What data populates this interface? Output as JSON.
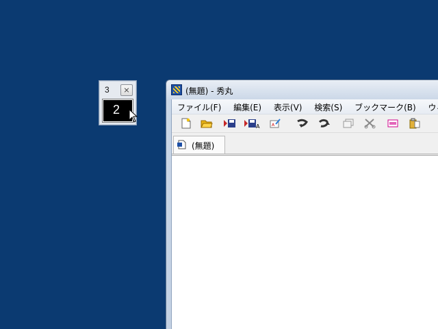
{
  "mini_window": {
    "title": "3",
    "display_number": "2"
  },
  "main_window": {
    "title": "(無題) - 秀丸",
    "menu": [
      "ファイル(F)",
      "編集(E)",
      "表示(V)",
      "検索(S)",
      "ブックマーク(B)",
      "ウィン"
    ],
    "toolbar": [
      "new-file-icon",
      "open-folder-icon",
      "save-icon",
      "save-as-icon",
      "print-preview-icon",
      "undo-icon",
      "redo-icon",
      "copy-icon",
      "cut-icon",
      "paste-special-icon",
      "clipboard-icon"
    ],
    "tab_label": "(無題)"
  },
  "colors": {
    "desktop": "#0b3a71",
    "window_frame": "#c9d6e7"
  }
}
